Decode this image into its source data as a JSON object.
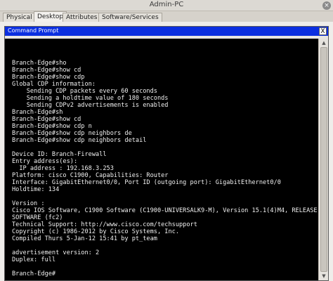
{
  "window": {
    "title": "Admin-PC",
    "close_glyph": "×"
  },
  "tabs": [
    {
      "label": "Physical",
      "active": false
    },
    {
      "label": "Desktop",
      "active": true
    },
    {
      "label": "Attributes",
      "active": false
    },
    {
      "label": "Software/Services",
      "active": false
    }
  ],
  "cmd": {
    "title": "Command Prompt",
    "close_glyph": "X",
    "lines": [
      "",
      "Branch-Edge#sho",
      "Branch-Edge#show cd",
      "Branch-Edge#show cdp",
      "Global CDP information:",
      "    Sending CDP packets every 60 seconds",
      "    Sending a holdtime value of 180 seconds",
      "    Sending CDPv2 advertisements is enabled",
      "Branch-Edge#sh",
      "Branch-Edge#show cd",
      "Branch-Edge#show cdp n",
      "Branch-Edge#show cdp neighbors de",
      "Branch-Edge#show cdp neighbors detail",
      "",
      "Device ID: Branch-Firewall",
      "Entry address(es):",
      "  IP address : 192.168.3.253",
      "Platform: cisco C1900, Capabilities: Router",
      "Interface: GigabitEthernet0/0, Port ID (outgoing port): GigabitEthernet0/0",
      "Holdtime: 134",
      "",
      "Version :",
      "Cisco IOS Software, C1900 Software (C1900-UNIVERSALK9-M), Version 15.1(4)M4, RELEASE",
      "SOFTWARE (fc2)",
      "Technical Support: http://www.cisco.com/techsupport",
      "Copyright (c) 1986-2012 by Cisco Systems, Inc.",
      "Compiled Thurs 5-Jan-12 15:41 by pt_team",
      "",
      "advertisement version: 2",
      "Duplex: full",
      "",
      "Branch-Edge#"
    ]
  },
  "scrollbar": {
    "up_glyph": "▲",
    "down_glyph": "▼"
  }
}
